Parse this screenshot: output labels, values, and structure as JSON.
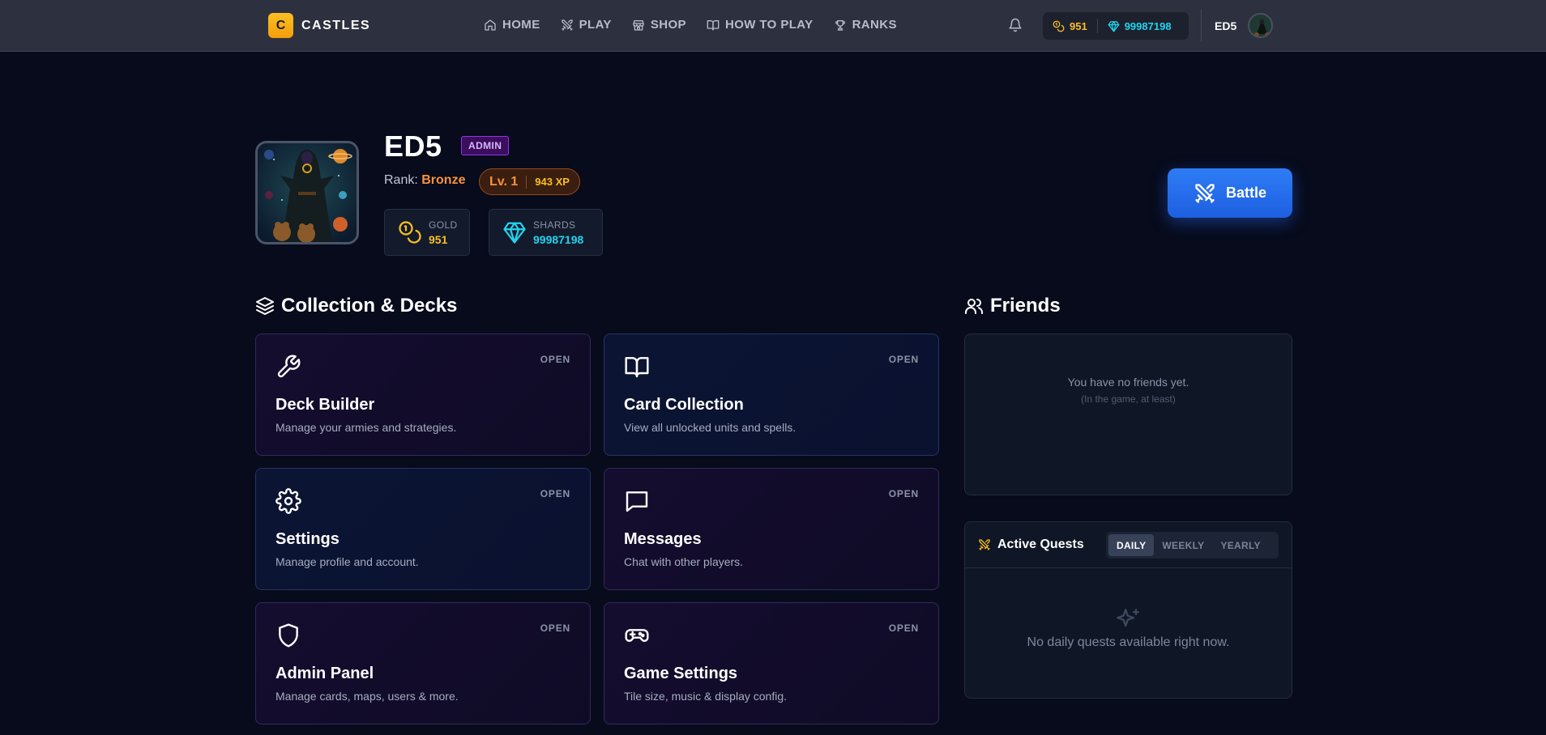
{
  "nav": {
    "logo_letter": "C",
    "brand": "CASTLES",
    "menu": [
      {
        "label": "HOME",
        "icon": "home-icon"
      },
      {
        "label": "PLAY",
        "icon": "swords-icon"
      },
      {
        "label": "SHOP",
        "icon": "store-icon"
      },
      {
        "label": "HOW TO PLAY",
        "icon": "book-icon"
      },
      {
        "label": "RANKS",
        "icon": "trophy-icon"
      }
    ],
    "gold": "951",
    "shards": "99987198",
    "username": "ED5"
  },
  "profile": {
    "name": "ED5",
    "badge": "ADMIN",
    "rank_label": "Rank:",
    "rank": "Bronze",
    "level": "Lv. 1",
    "xp": "943 XP",
    "gold_label": "GOLD",
    "gold": "951",
    "shards_label": "SHARDS",
    "shards": "99987198",
    "battle_label": "Battle"
  },
  "collection": {
    "title": "Collection & Decks",
    "cards": [
      {
        "title": "Deck Builder",
        "desc": "Manage your armies and strategies.",
        "open": "OPEN",
        "icon": "wrench-icon"
      },
      {
        "title": "Card Collection",
        "desc": "View all unlocked units and spells.",
        "open": "OPEN",
        "icon": "book-open-icon"
      },
      {
        "title": "Settings",
        "desc": "Manage profile and account.",
        "open": "OPEN",
        "icon": "gear-icon"
      },
      {
        "title": "Messages",
        "desc": "Chat with other players.",
        "open": "OPEN",
        "icon": "message-icon"
      },
      {
        "title": "Admin Panel",
        "desc": "Manage cards, maps, users & more.",
        "open": "OPEN",
        "icon": "shield-icon"
      },
      {
        "title": "Game Settings",
        "desc": "Tile size, music & display config.",
        "open": "OPEN",
        "icon": "gamepad-icon"
      }
    ]
  },
  "friends": {
    "title": "Friends",
    "empty": "You have no friends yet.",
    "empty_sub": "(In the game, at least)"
  },
  "quests": {
    "title": "Active Quests",
    "tabs": [
      "DAILY",
      "WEEKLY",
      "YEARLY"
    ],
    "active_tab": "DAILY",
    "empty": "No daily quests available right now."
  },
  "colors": {
    "gold": "#fbbf24",
    "shards": "#22d3ee",
    "accent_blue": "#2563eb",
    "rank_orange": "#fb923c",
    "admin_purple": "#9333ea"
  }
}
